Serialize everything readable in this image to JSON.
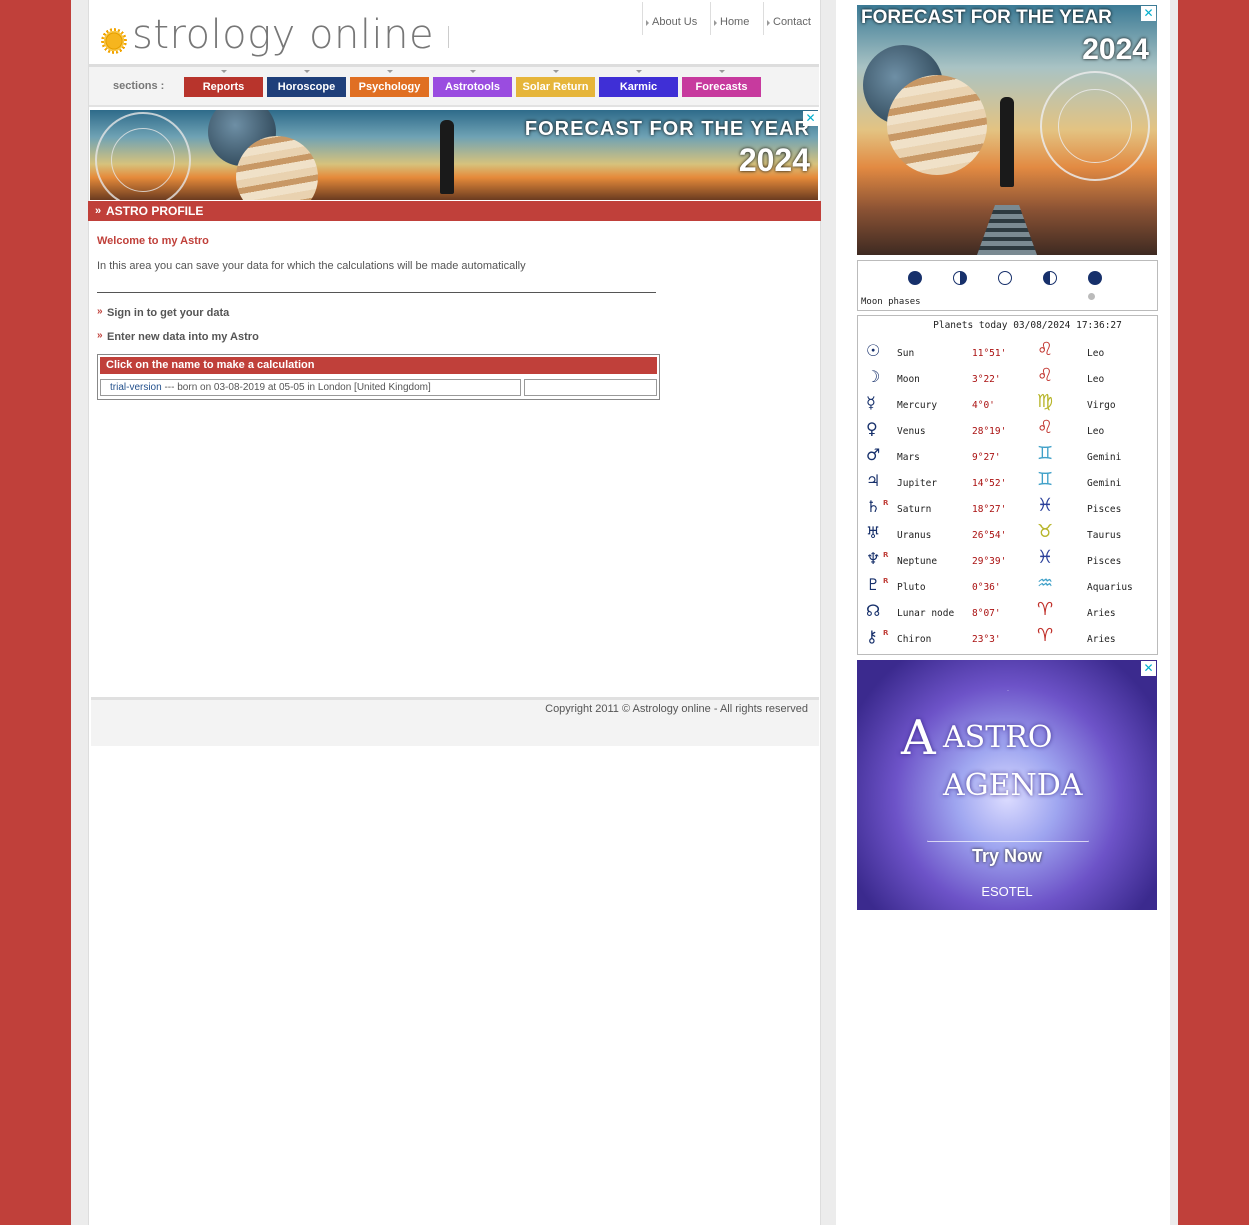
{
  "header": {
    "logo_text": "strology online",
    "topnav": [
      "About Us",
      "Home",
      "Contact"
    ]
  },
  "sections": {
    "label": "sections :",
    "buttons": [
      {
        "label": "Reports",
        "color": "#b8342c"
      },
      {
        "label": "Horoscope",
        "color": "#1f3f7a"
      },
      {
        "label": "Psychology",
        "color": "#e06f22"
      },
      {
        "label": "Astrotools",
        "color": "#9a4ce0"
      },
      {
        "label": "Solar Return",
        "color": "#e6b53a"
      },
      {
        "label": "Karmic",
        "color": "#3f2fd6"
      },
      {
        "label": "Forecasts",
        "color": "#c73a9e"
      }
    ]
  },
  "banner": {
    "line1": "FORECAST FOR THE YEAR",
    "line2": "2024"
  },
  "profile": {
    "title": "ASTRO PROFILE",
    "welcome": "Welcome to my Astro",
    "intro": "In this area you can save your data for which the calculations will be made automatically",
    "link_signin": "Sign in to get your data",
    "link_new": "Enter new data into my Astro",
    "table_header": "Click on the name to make a calculation",
    "entry_name": "trial-version",
    "entry_sep": " --- ",
    "entry_text": "born on  03-08-2019 at 05-05 in London [United Kingdom]"
  },
  "footer": {
    "copyright": "Copyright 2011 © Astrology online - All rights reserved"
  },
  "sidebar": {
    "ad_top": {
      "line1": "FORECAST FOR THE YEAR",
      "line2": "2024"
    },
    "moon_phases_label": "Moon phases",
    "planets_title": "Planets today  03/08/2024 17:36:27",
    "planets": [
      {
        "glyph": "☉",
        "retro": "",
        "name": "Sun",
        "deg": "11°51'",
        "sign_glyph": "♌",
        "sign": "Leo",
        "sign_color": "#c0302a"
      },
      {
        "glyph": "☽",
        "retro": "",
        "name": "Moon",
        "deg": "3°22'",
        "sign_glyph": "♌",
        "sign": "Leo",
        "sign_color": "#c0302a"
      },
      {
        "glyph": "☿",
        "retro": "",
        "name": "Mercury",
        "deg": "4°0'",
        "sign_glyph": "♍",
        "sign": "Virgo",
        "sign_color": "#b7b52a"
      },
      {
        "glyph": "♀",
        "retro": "",
        "name": "Venus",
        "deg": "28°19'",
        "sign_glyph": "♌",
        "sign": "Leo",
        "sign_color": "#c0302a"
      },
      {
        "glyph": "♂",
        "retro": "",
        "name": "Mars",
        "deg": "9°27'",
        "sign_glyph": "♊",
        "sign": "Gemini",
        "sign_color": "#3fa0c8"
      },
      {
        "glyph": "♃",
        "retro": "",
        "name": "Jupiter",
        "deg": "14°52'",
        "sign_glyph": "♊",
        "sign": "Gemini",
        "sign_color": "#3fa0c8"
      },
      {
        "glyph": "♄",
        "retro": "R",
        "name": "Saturn",
        "deg": "18°27'",
        "sign_glyph": "♓",
        "sign": "Pisces",
        "sign_color": "#2a3f9a"
      },
      {
        "glyph": "♅",
        "retro": "",
        "name": "Uranus",
        "deg": "26°54'",
        "sign_glyph": "♉",
        "sign": "Taurus",
        "sign_color": "#b7b52a"
      },
      {
        "glyph": "♆",
        "retro": "R",
        "name": "Neptune",
        "deg": "29°39'",
        "sign_glyph": "♓",
        "sign": "Pisces",
        "sign_color": "#2a3f9a"
      },
      {
        "glyph": "♇",
        "retro": "R",
        "name": "Pluto",
        "deg": "0°36'",
        "sign_glyph": "♒",
        "sign": "Aquarius",
        "sign_color": "#3fa0c8"
      },
      {
        "glyph": "☊",
        "retro": "",
        "name": "Lunar node",
        "deg": "8°07'",
        "sign_glyph": "♈",
        "sign": "Aries",
        "sign_color": "#c0302a"
      },
      {
        "glyph": "⚷",
        "retro": "R",
        "name": "Chiron",
        "deg": "23°3'",
        "sign_glyph": "♈",
        "sign": "Aries",
        "sign_color": "#c0302a"
      }
    ],
    "ad_bottom": {
      "line1": "ASTRO",
      "line2": "AGENDA",
      "cta": "Try Now",
      "brand": "ESOTEL"
    }
  }
}
